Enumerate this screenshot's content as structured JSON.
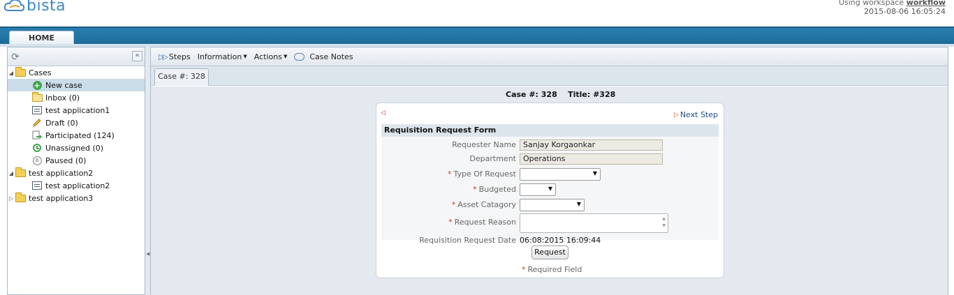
{
  "header": {
    "logo_text": "bista",
    "workspace_label": "Using workspace",
    "workspace_name": "workflow",
    "datetime": "2015-08-06 16:05:24"
  },
  "nav": {
    "home_tab": "HOME"
  },
  "sidebar": {
    "refresh_icon": "refresh-icon",
    "collapse_glyph": "«",
    "items": [
      {
        "label": "Cases",
        "icon": "cases-folder-icon"
      },
      {
        "label": "New case",
        "icon": "new-case-icon"
      },
      {
        "label": "Inbox (0)",
        "icon": "inbox-icon"
      },
      {
        "label": "test application1",
        "icon": "form-icon"
      },
      {
        "label": "Draft (0)",
        "icon": "pencil-icon"
      },
      {
        "label": "Participated (124)",
        "icon": "participated-icon"
      },
      {
        "label": "Unassigned (0)",
        "icon": "unassigned-icon"
      },
      {
        "label": "Paused (0)",
        "icon": "pause-icon"
      },
      {
        "label": "test application2",
        "icon": "folder-icon"
      },
      {
        "label": "test application2",
        "icon": "form-icon"
      },
      {
        "label": "test application3",
        "icon": "folder-icon"
      }
    ]
  },
  "toolbar": {
    "steps": "Steps",
    "information": "Information",
    "actions": "Actions",
    "case_notes": "Case Notes"
  },
  "case_tab": "Case #: 328",
  "case_header": {
    "case_number": "Case #: 328",
    "title": "Title: #328"
  },
  "form": {
    "next_step": "Next Step",
    "title": "Requisition Request Form",
    "fields": {
      "requester_name": {
        "label": "Requester Name",
        "value": "Sanjay Korgaonkar"
      },
      "department": {
        "label": "Department",
        "value": "Operations"
      },
      "type_of_request": {
        "label": "Type Of Request",
        "value": ""
      },
      "budgeted": {
        "label": "Budgeted",
        "value": ""
      },
      "asset_category": {
        "label": "Asset Catagory",
        "value": ""
      },
      "request_reason": {
        "label": "Request Reason",
        "value": ""
      },
      "request_date": {
        "label": "Requisition Request Date",
        "value": "06:08:2015 16:09:44"
      }
    },
    "required_marker": "*",
    "submit_label": "Request",
    "required_note": "Required Field"
  },
  "colors": {
    "nav_bar": "#2a7fae",
    "brand": "#3e87c9",
    "required": "#c4381f",
    "selected_row": "#cbdde9"
  }
}
